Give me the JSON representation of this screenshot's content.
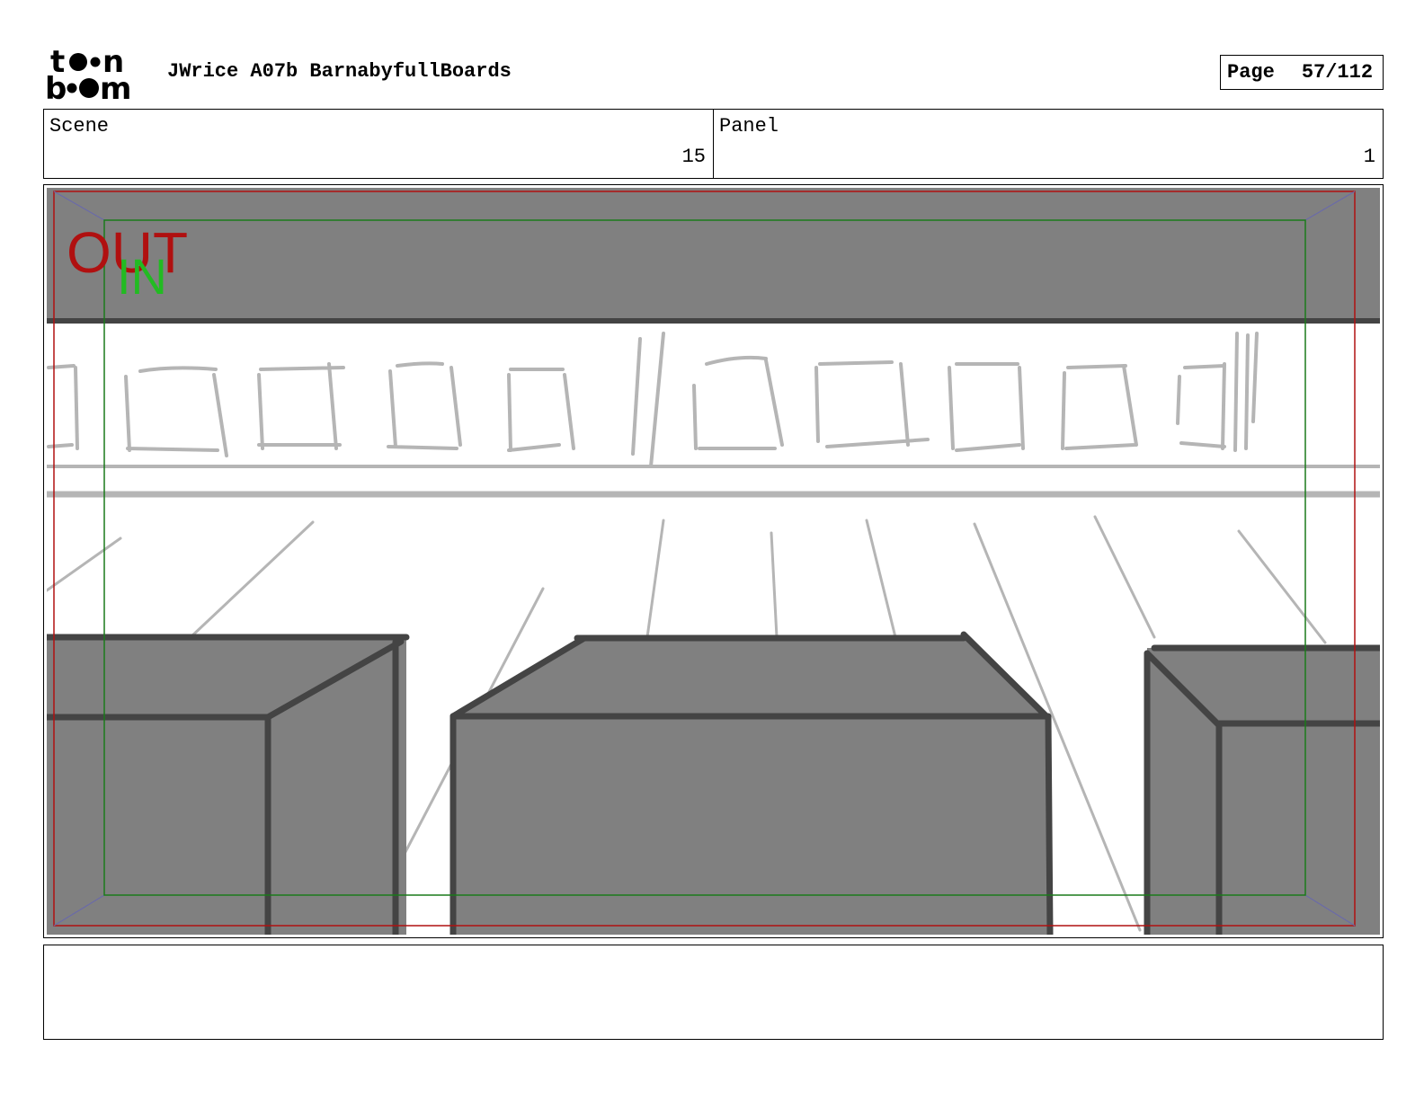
{
  "header": {
    "logo_text": "toon boom",
    "document_title": "JWrice A07b BarnabyfullBoards",
    "page_label": "Page",
    "page_number": "57/112"
  },
  "info": {
    "scene_label": "Scene",
    "scene_value": "15",
    "panel_label": "Panel",
    "panel_value": "1"
  },
  "panel": {
    "out_label": "OUT",
    "in_label": "IN",
    "colors": {
      "out_frame": "#b01010",
      "in_frame": "#1a7a1a",
      "in_text": "#22bb22",
      "fill_gray": "#808080",
      "stroke_dark": "#444444",
      "stroke_light": "#b5b5b5"
    }
  },
  "notes": {
    "text": ""
  }
}
